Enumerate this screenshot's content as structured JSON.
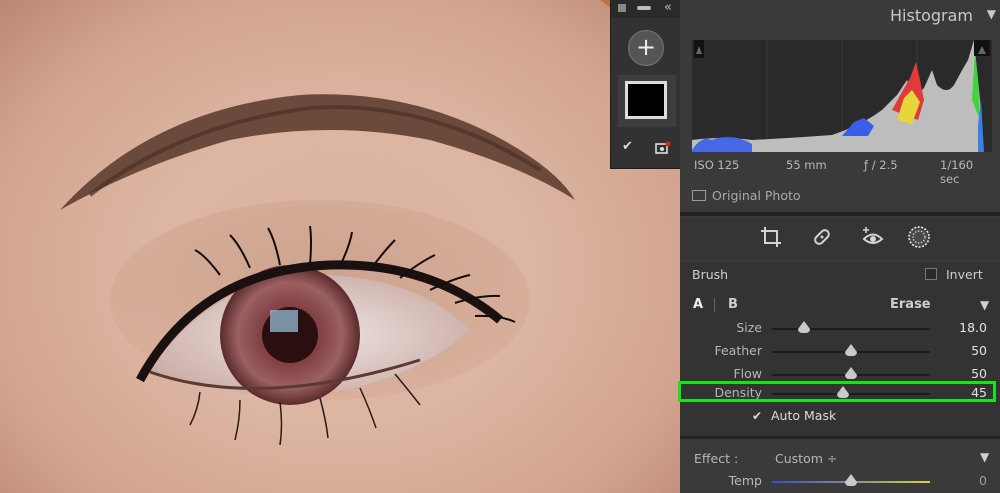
{
  "mask_panel": {
    "add_glyph": "+",
    "collapse_glyph": "«",
    "show_overlay_glyph": "✔"
  },
  "histogram": {
    "title": "Histogram",
    "collapse_glyph": "▼",
    "exif": {
      "iso": "ISO 125",
      "focal": "55 mm",
      "aperture": "ƒ / 2.5",
      "shutter": "1/160 sec"
    },
    "original_photo": "Original Photo"
  },
  "tools": [
    "crop-icon",
    "healing-icon",
    "red-eye-icon",
    "masking-icon"
  ],
  "brush": {
    "label": "Brush",
    "invert_label": "Invert",
    "tab_a": "A",
    "tab_b": "B",
    "erase": "Erase",
    "erase_glyph": "▼",
    "sliders": [
      {
        "label": "Size",
        "value": "18.0",
        "position": 0.2
      },
      {
        "label": "Feather",
        "value": "50",
        "position": 0.5
      },
      {
        "label": "Flow",
        "value": "50",
        "position": 0.5
      },
      {
        "label": "Density",
        "value": "45",
        "position": 0.45
      }
    ],
    "auto_mask_label": "Auto Mask",
    "auto_mask_glyph": "✔"
  },
  "effect": {
    "label": "Effect :",
    "value": "Custom ÷",
    "glyph": "▼",
    "temp_label": "Temp",
    "temp_value": "0",
    "temp_position": 0.5
  },
  "colors": {
    "highlight": "#19e219",
    "panel": "#3a3a3a"
  }
}
